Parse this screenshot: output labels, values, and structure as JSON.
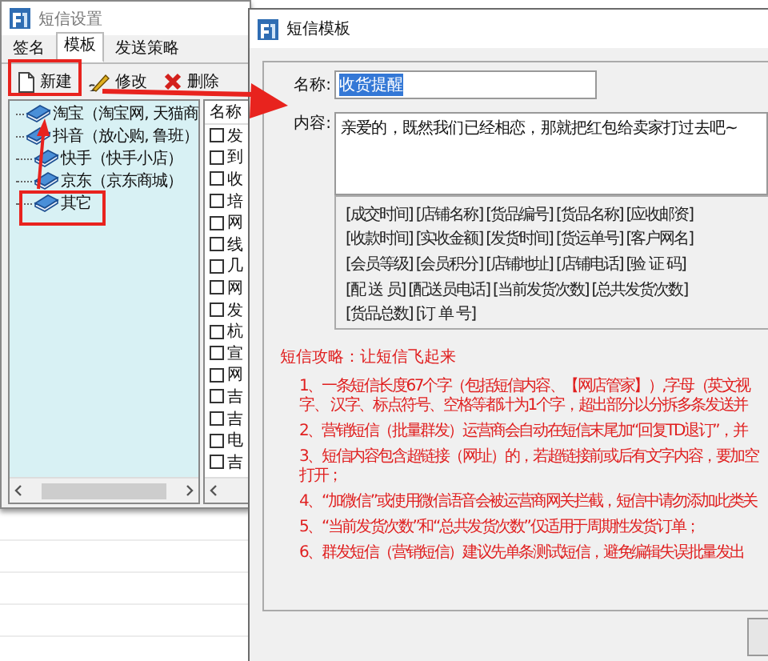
{
  "back_window": {
    "title": "短信设置",
    "tabs": [
      {
        "label": "签名",
        "selected": false
      },
      {
        "label": "模板",
        "selected": true
      },
      {
        "label": "发送策略",
        "selected": false
      }
    ],
    "toolbar": [
      {
        "label": "新建",
        "kind": "new"
      },
      {
        "label": "修改",
        "kind": "edit"
      },
      {
        "label": "删除",
        "kind": "delete"
      }
    ],
    "tree": [
      {
        "label": "淘宝（淘宝网, 天猫商"
      },
      {
        "label": "抖音（放心购, 鲁班）"
      },
      {
        "label": "快手（快手小店）"
      },
      {
        "label": "京东（京东商城）"
      },
      {
        "label": "其它"
      }
    ],
    "list": {
      "header": "名称",
      "rows": [
        {
          "name": "发",
          "checked": false
        },
        {
          "name": "到",
          "checked": false
        },
        {
          "name": "收",
          "checked": false
        },
        {
          "name": "培",
          "checked": false
        },
        {
          "name": "网",
          "checked": false
        },
        {
          "name": "线",
          "checked": false
        },
        {
          "name": "几",
          "checked": false
        },
        {
          "name": "网",
          "checked": false
        },
        {
          "name": "发",
          "checked": false
        },
        {
          "name": "杭",
          "checked": false
        },
        {
          "name": "宣",
          "checked": false
        },
        {
          "name": "网",
          "checked": false
        },
        {
          "name": "吉",
          "checked": false
        },
        {
          "name": "吉",
          "checked": false
        },
        {
          "name": "电",
          "checked": false
        },
        {
          "name": "吉",
          "checked": false
        }
      ]
    }
  },
  "front_window": {
    "title": "短信模板",
    "name_field": {
      "label": "名称:",
      "value": "收货提醒",
      "text_selected": true
    },
    "content_field": {
      "label": "内容:",
      "value": "亲爱的，既然我们已经相恋，那就把红包给卖家打过去吧~"
    },
    "variables": [
      [
        "[成交时间]",
        "[店铺名称]",
        "[货品编号]",
        "[货品名称]",
        "[应收邮资]"
      ],
      [
        "[收款时间]",
        "[实收金额]",
        "[发货时间]",
        "[货运单号]",
        "[客户网名]"
      ],
      [
        "[会员等级]",
        "[会员积分]",
        "[店铺地址]",
        "[店铺电话]",
        "[验 证 码]"
      ],
      [
        "[配 送 员]",
        "[配送员电话]",
        "[当前发货次数]",
        "[总共发货次数]"
      ],
      [
        "[货品总数]",
        "[订 单 号]"
      ]
    ],
    "tips_title": "短信攻略：让短信飞起来",
    "tips": [
      [
        "1、一条短信长度67个字（包括短信内容、【网店管家】）,字母（英文视",
        "字、 汉字、标点符号、空格等都计为1个字，超出部分以分拆多条发送并"
      ],
      [
        "2、营销短信（批量群发）运营商会自动在短信末尾加“回复TD退订”，并"
      ],
      [
        "3、短信内容包含超链接（网址）的，若超链接前或后有文字内容，要加空",
        "打开；"
      ],
      [
        "4、“加微信”或使用微信语音会被运营商网关拦截，短信中请勿添加此类关"
      ],
      [
        "5、“当前发货次数”和“总共发货次数”仅适用于周期性发货订单；"
      ],
      [
        "6、群发短信（营销短信）建议先单条测试短信，避免编辑失误批量发出"
      ]
    ]
  }
}
